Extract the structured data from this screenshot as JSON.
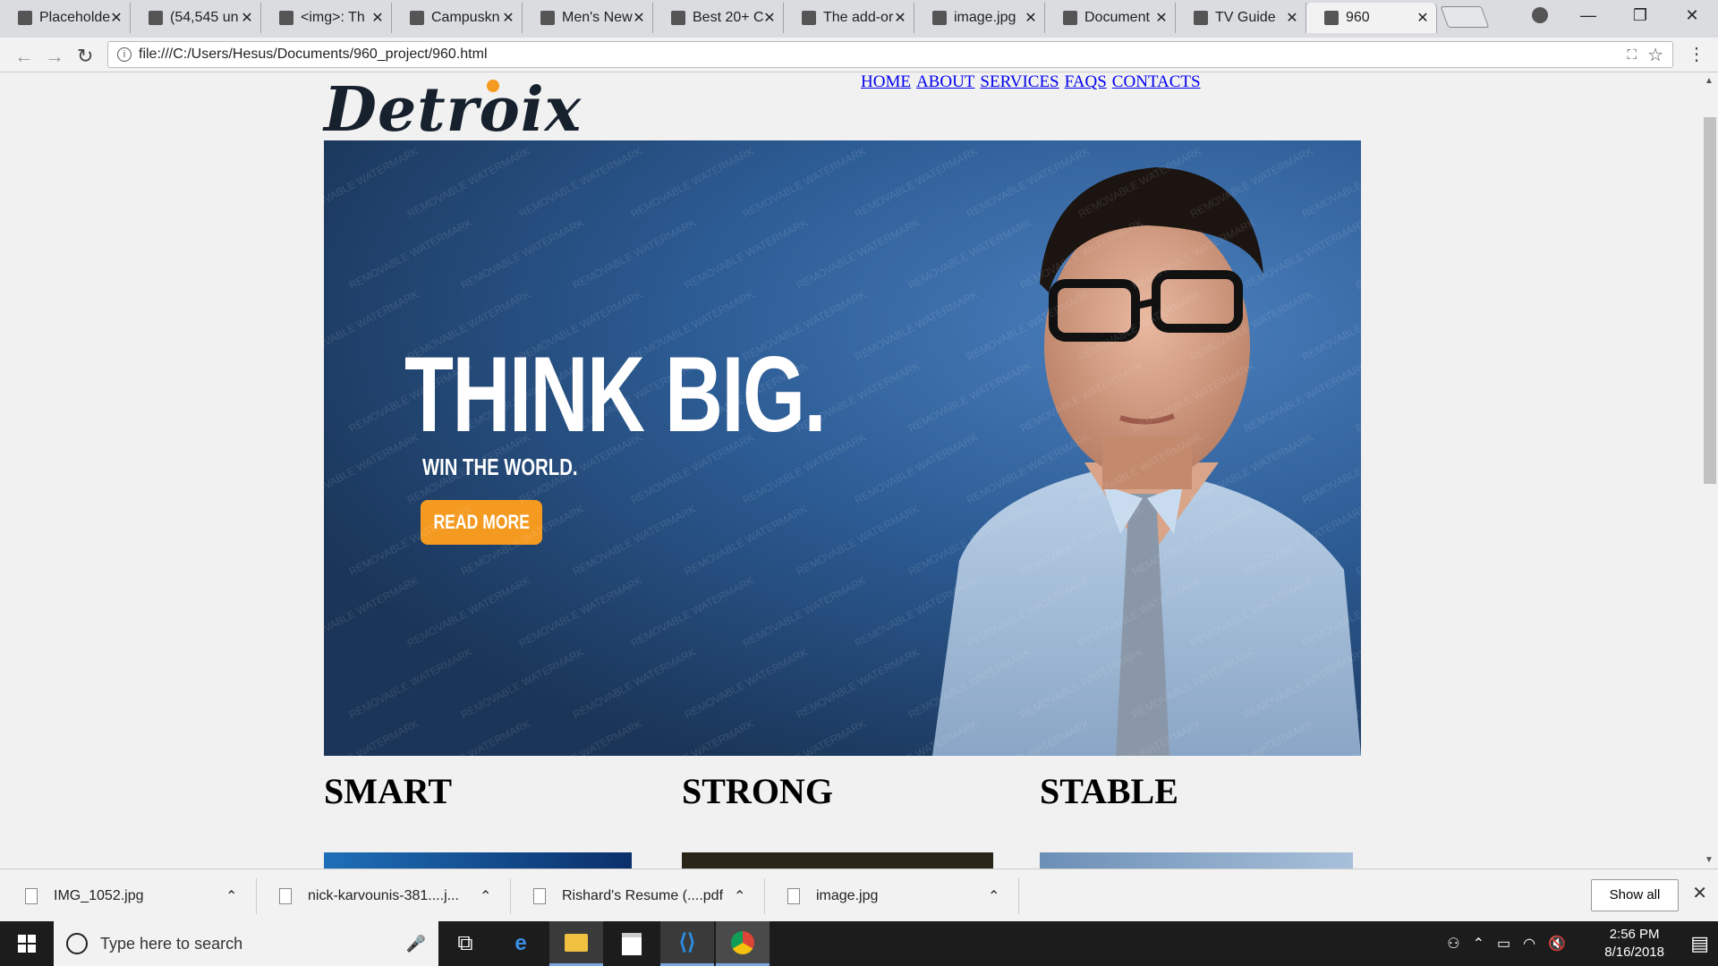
{
  "browser": {
    "tabs": [
      {
        "title": "Placeholde",
        "favicon": "placeholder-icon"
      },
      {
        "title": "(54,545 un",
        "favicon": "mail-icon"
      },
      {
        "title": "<img>: Th",
        "favicon": "mdn-icon"
      },
      {
        "title": "Campuskn",
        "favicon": "campus-icon"
      },
      {
        "title": "Men's New",
        "favicon": "z-icon"
      },
      {
        "title": "Best 20+ C",
        "favicon": "camera-icon"
      },
      {
        "title": "The add-or",
        "favicon": "mdn-icon"
      },
      {
        "title": "image.jpg",
        "favicon": "document-icon"
      },
      {
        "title": "Document",
        "favicon": "document-icon"
      },
      {
        "title": "TV Guide",
        "favicon": "document-icon"
      },
      {
        "title": "960",
        "favicon": "document-icon"
      }
    ],
    "active_tab": 10,
    "url": "file:///C:/Users/Hesus/Documents/960_project/960.html"
  },
  "page": {
    "logo": "Detroix",
    "nav": [
      "HOME",
      "ABOUT",
      "SERVICES",
      "FAQS",
      "CONTACTS"
    ],
    "hero": {
      "headline": "THINK BIG.",
      "subline": "WIN THE WORLD.",
      "button": "READ MORE",
      "watermark": "REMOVABLE WATERMARK"
    },
    "columns": [
      "SMART",
      "STRONG",
      "STABLE"
    ]
  },
  "downloads": {
    "items": [
      "IMG_1052.jpg",
      "nick-karvounis-381....j...",
      "Rishard's Resume (....pdf",
      "image.jpg"
    ],
    "show_all": "Show all"
  },
  "taskbar": {
    "search_placeholder": "Type here to search",
    "time": "2:56 PM",
    "date": "8/16/2018"
  },
  "colors": {
    "accent_orange": "#f59a20",
    "link_blue": "#0000ee",
    "hero_blue": "#2c5b93"
  }
}
